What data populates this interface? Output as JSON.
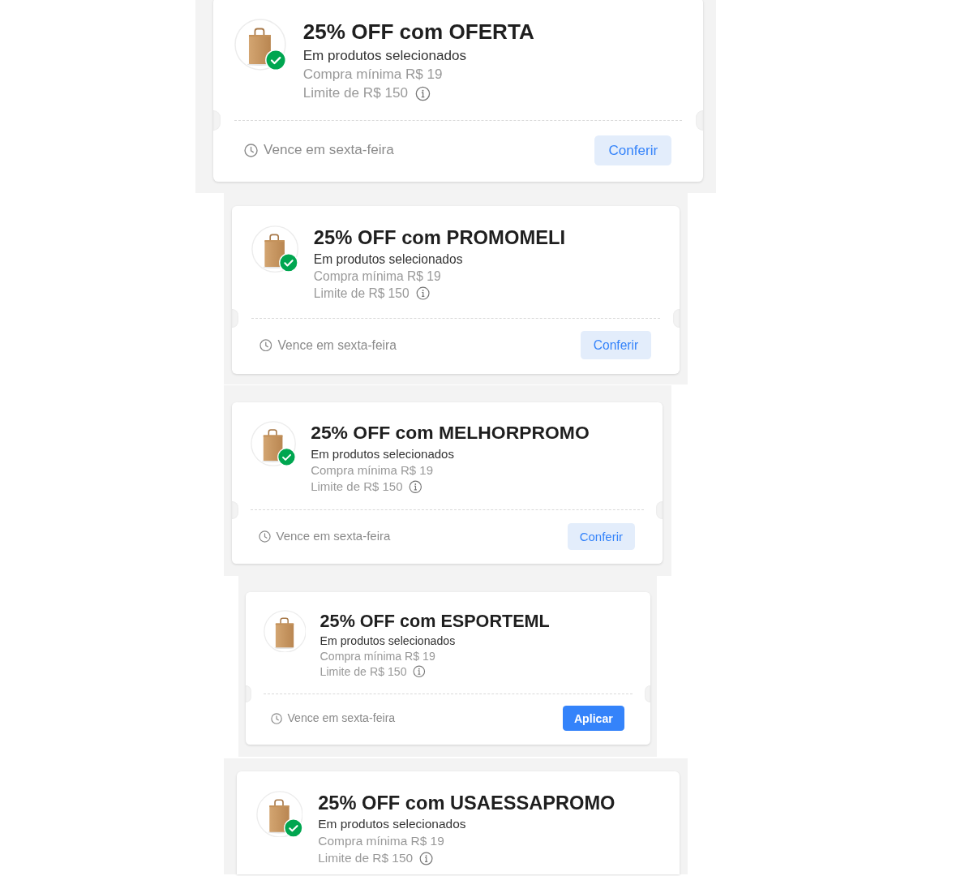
{
  "coupons": [
    {
      "title": "25% OFF com OFERTA",
      "subtitle": "Em produtos selecionados",
      "minimum": "Compra mínima R$ 19",
      "limit": "Limite de R$ 150",
      "checked": true,
      "expiry": "Vence em sexta-feira",
      "button": {
        "label": "Conferir",
        "kind": "secondary"
      }
    },
    {
      "title": "25% OFF com PROMOMELI",
      "subtitle": "Em produtos selecionados",
      "minimum": "Compra mínima R$ 19",
      "limit": "Limite de R$ 150",
      "checked": true,
      "expiry": "Vence em sexta-feira",
      "button": {
        "label": "Conferir",
        "kind": "secondary"
      }
    },
    {
      "title": "25% OFF com MELHORPROMO",
      "subtitle": "Em produtos selecionados",
      "minimum": "Compra mínima R$ 19",
      "limit": "Limite de R$ 150",
      "checked": true,
      "expiry": "Vence em sexta-feira",
      "button": {
        "label": "Conferir",
        "kind": "secondary"
      }
    },
    {
      "title": "25% OFF com ESPORTEML",
      "subtitle": "Em produtos selecionados",
      "minimum": "Compra mínima R$ 19",
      "limit": "Limite de R$ 150",
      "checked": false,
      "expiry": "Vence em sexta-feira",
      "button": {
        "label": "Aplicar",
        "kind": "primary"
      }
    },
    {
      "title": "25% OFF com USAESSAPROMO",
      "subtitle": "Em produtos selecionados",
      "minimum": "Compra mínima R$ 19",
      "limit": "Limite de R$ 150",
      "checked": true
    }
  ]
}
